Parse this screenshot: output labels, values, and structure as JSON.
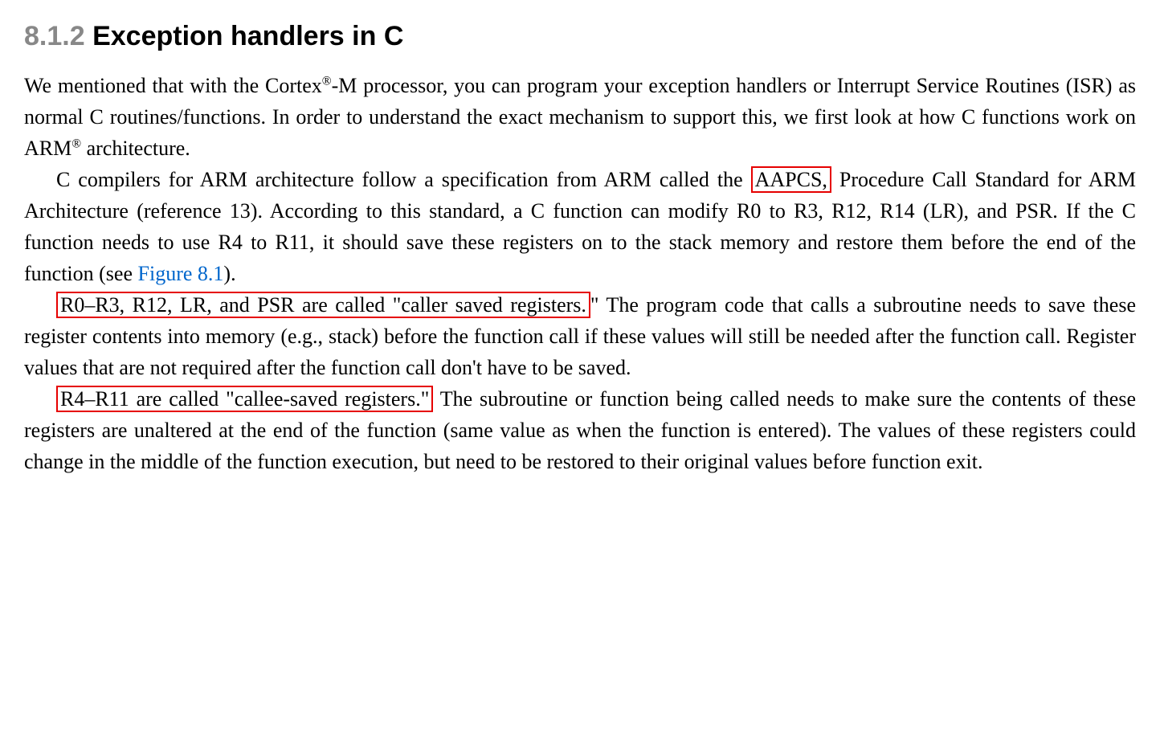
{
  "heading": {
    "number": "8.1.2",
    "title": "Exception handlers in C"
  },
  "p1": {
    "t1": "We mentioned that with the Cortex",
    "sup1": "®",
    "t2": "-M processor, you can program your exception handlers or Interrupt Service Routines (ISR) as normal C routines/functions. In order to understand the exact mechanism to support this, we first look at how C functions work on ARM",
    "sup2": "®",
    "t3": " architecture."
  },
  "p2": {
    "t1": "C compilers for ARM architecture follow a specification from ARM called the ",
    "box1": "AAPCS,",
    "t2": " Procedure Call Standard for ARM Architecture (reference 13). According to this standard, a C function can modify R0 to R3, R12, R14 (LR), and PSR. If the C function needs to use R4 to R11, it should save these registers on to the stack memory and restore them before the end of the function (see ",
    "link1": "Figure 8.1",
    "t3": ")."
  },
  "p3": {
    "box1": "R0–R3, R12, LR, and PSR are called \"caller saved registers.",
    "t1": "\" The program code that calls a subroutine needs to save these register contents into memory (e.g., stack) before the function call if these values will still be needed after the function call. Register values that are not required after the function call don't have to be saved."
  },
  "p4": {
    "box1": "R4–R11 are called \"callee-saved registers.\"",
    "t1": " The subroutine or function being called needs to make sure the contents of these registers are unaltered at the end of the function (same value as when the function is entered). The values of these registers could change in the middle of the function execution, but need to be restored to their original values before function exit."
  }
}
